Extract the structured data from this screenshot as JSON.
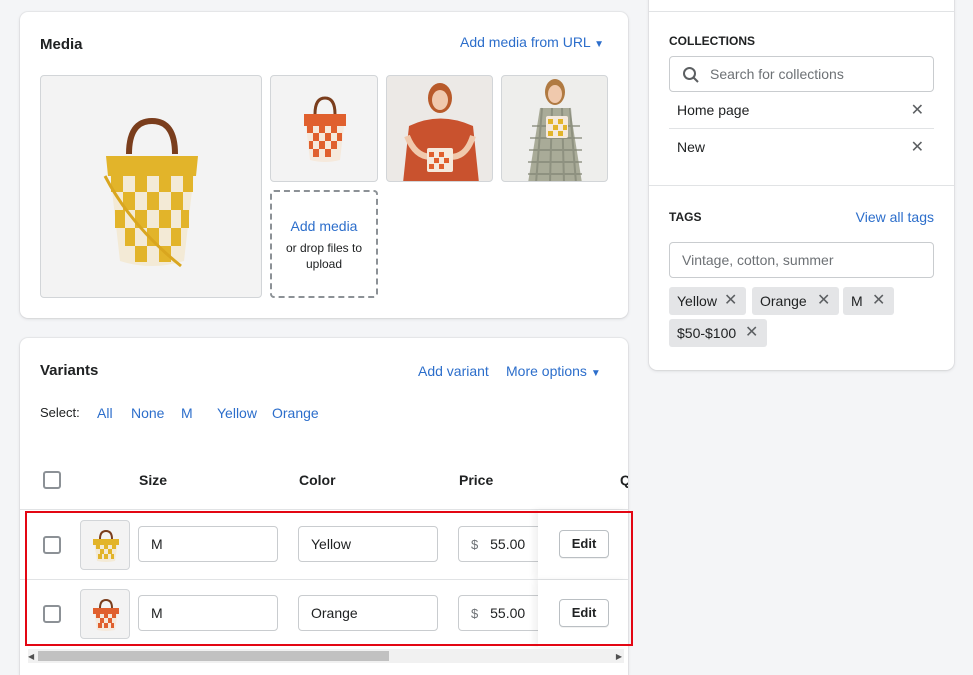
{
  "media": {
    "title": "Media",
    "add_url_label": "Add media from URL",
    "add_media_label": "Add media",
    "drop_label": "or drop files to upload"
  },
  "variants": {
    "title": "Variants",
    "add_variant_label": "Add variant",
    "more_options_label": "More options",
    "select_label": "Select:",
    "select_options": [
      "All",
      "None",
      "M",
      "Yellow",
      "Orange"
    ],
    "columns": [
      "Size",
      "Color",
      "Price",
      "Q"
    ],
    "rows": [
      {
        "size": "M",
        "color": "Yellow",
        "currency": "$",
        "price": "55.00",
        "edit": "Edit"
      },
      {
        "size": "M",
        "color": "Orange",
        "currency": "$",
        "price": "55.00",
        "edit": "Edit"
      }
    ]
  },
  "collections": {
    "title": "COLLECTIONS",
    "search_placeholder": "Search for collections",
    "items": [
      "Home page",
      "New"
    ]
  },
  "tags": {
    "title": "TAGS",
    "view_all_label": "View all tags",
    "input_placeholder": "Vintage, cotton, summer",
    "items": [
      "Yellow",
      "Orange",
      "M",
      "$50-$100"
    ]
  },
  "colors": {
    "accent": "#2c6ecb",
    "highlight": "#e30613",
    "yellow_bag": "#e2b42a",
    "orange_bag": "#e0602e"
  }
}
